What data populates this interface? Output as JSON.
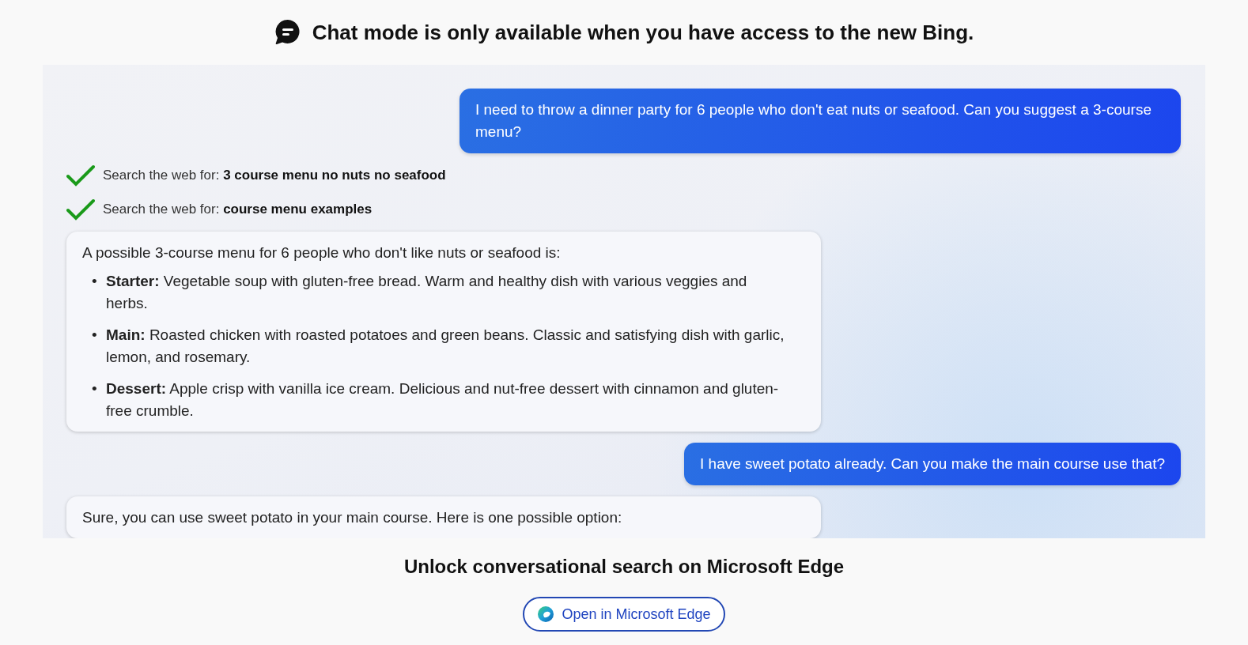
{
  "banner": {
    "title": "Chat mode is only available when you have access to the new Bing."
  },
  "messages": [
    {
      "kind": "user",
      "text": "I need to throw a dinner party for 6 people who don't eat nuts or seafood. Can you suggest a 3-course menu?"
    },
    {
      "kind": "search",
      "text": "Search the web for: **3 course menu no nuts no seafood**",
      "done": true
    },
    {
      "kind": "search",
      "text": "Search the web for: **course menu examples**",
      "done": true
    },
    {
      "kind": "bot",
      "text": "A possible 3-course menu for 6 people who don't like nuts or seafood is:",
      "items": [
        {
          "bullet": "•",
          "text": "**Starter:** Vegetable soup with gluten-free bread. Warm and healthy dish with various veggies and herbs."
        },
        {
          "bullet": "•",
          "text": "**Main:** Roasted chicken with roasted potatoes and green beans. Classic and satisfying dish with garlic, lemon, and rosemary."
        },
        {
          "bullet": "•",
          "text": "**Dessert:** Apple crisp with vanilla ice cream. Delicious and nut-free dessert with cinnamon and gluten-free crumble."
        }
      ]
    },
    {
      "kind": "user",
      "text": "I have sweet potato already. Can you make the main course use that?"
    },
    {
      "kind": "bot",
      "text": "Sure, you can use sweet potato in your main course. Here is one possible option:"
    }
  ],
  "footer": {
    "title": "Unlock conversational search on Microsoft Edge",
    "button": "Open in Microsoft Edge"
  }
}
